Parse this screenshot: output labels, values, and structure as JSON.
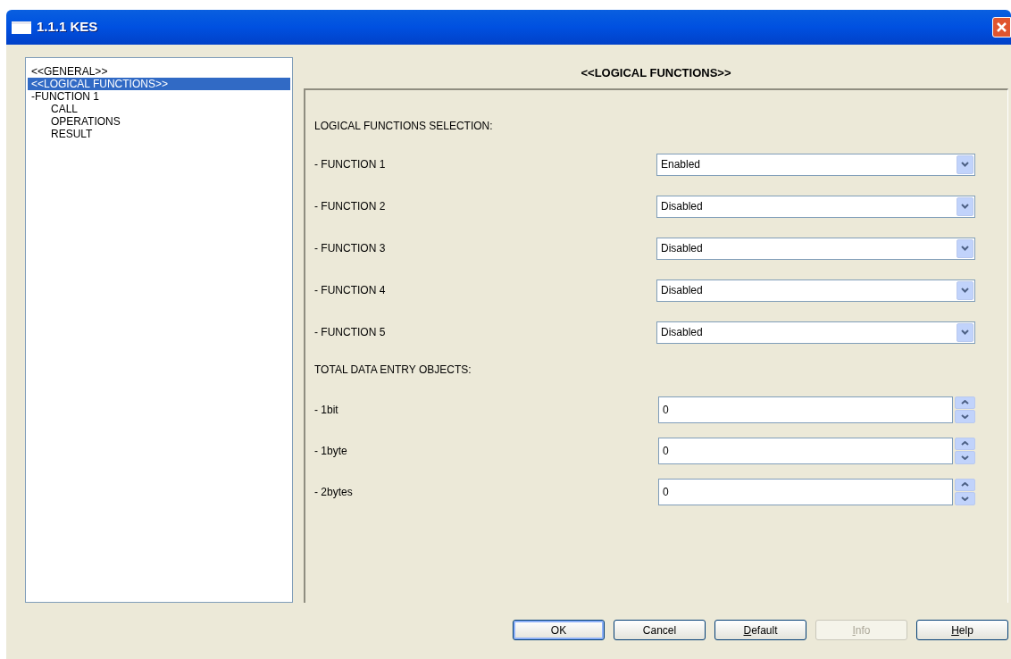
{
  "window": {
    "title": "1.1.1 KES"
  },
  "tree": [
    {
      "label": "<<GENERAL>>",
      "selected": false
    },
    {
      "label": "<<LOGICAL FUNCTIONS>>",
      "selected": true
    },
    {
      "label": "-FUNCTION 1",
      "selected": false,
      "children": [
        {
          "label": "CALL",
          "selected": false
        },
        {
          "label": "OPERATIONS",
          "selected": false
        },
        {
          "label": "RESULT",
          "selected": false
        }
      ]
    }
  ],
  "panel": {
    "heading": "<<LOGICAL FUNCTIONS>>",
    "rows": [
      {
        "kind": "section",
        "label": "LOGICAL FUNCTIONS SELECTION:"
      },
      {
        "kind": "combo",
        "label": "- FUNCTION 1",
        "value": "Enabled"
      },
      {
        "kind": "combo",
        "label": "- FUNCTION 2",
        "value": "Disabled"
      },
      {
        "kind": "combo",
        "label": "- FUNCTION 3",
        "value": "Disabled"
      },
      {
        "kind": "combo",
        "label": "- FUNCTION 4",
        "value": "Disabled"
      },
      {
        "kind": "combo",
        "label": "- FUNCTION 5",
        "value": "Disabled"
      },
      {
        "kind": "section",
        "label": "TOTAL DATA ENTRY OBJECTS:"
      },
      {
        "kind": "spin",
        "label": "- 1bit",
        "value": "0"
      },
      {
        "kind": "spin",
        "label": "- 1byte",
        "value": "0"
      },
      {
        "kind": "spin",
        "label": "- 2bytes",
        "value": "0"
      }
    ]
  },
  "buttons": [
    {
      "label": "OK",
      "default": true,
      "disabled": false,
      "access_key": false
    },
    {
      "label": "Cancel",
      "default": false,
      "disabled": false,
      "access_key": false
    },
    {
      "label": "Default",
      "default": false,
      "disabled": false,
      "access_key": true
    },
    {
      "label": "Info",
      "default": false,
      "disabled": true,
      "access_key": true
    },
    {
      "label": "Help",
      "default": false,
      "disabled": false,
      "access_key": true
    }
  ]
}
